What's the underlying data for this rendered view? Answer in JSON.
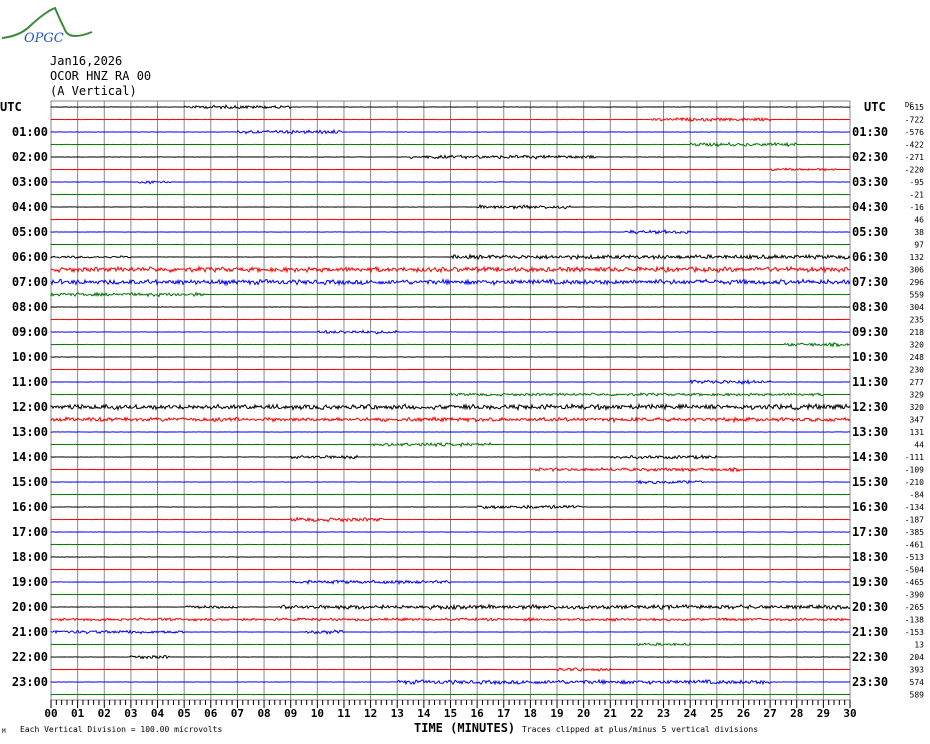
{
  "logo": {
    "text": "OPGC",
    "colors": {
      "curve": "#3a8a3a",
      "text": "#2255cc"
    }
  },
  "header": {
    "date": "Jan16,2026",
    "station": "OCOR HNZ RA 00",
    "component": "(A Vertical)"
  },
  "footer": {
    "corner": "M",
    "scale_note": "Each Vertical Division =  100.00 microvolts",
    "clip_note": "Traces clipped at plus/minus 5 vertical divisions"
  },
  "chart_data": {
    "type": "line",
    "title": "OCOR HNZ RA 00 helicorder",
    "xlabel": "TIME (MINUTES)",
    "xlim": [
      0,
      30
    ],
    "x_ticks": [
      "00",
      "01",
      "02",
      "03",
      "04",
      "05",
      "06",
      "07",
      "08",
      "09",
      "10",
      "11",
      "12",
      "13",
      "14",
      "15",
      "16",
      "17",
      "18",
      "19",
      "20",
      "21",
      "22",
      "23",
      "24",
      "25",
      "26",
      "27",
      "28",
      "29",
      "30"
    ],
    "left_axis_title": "UTC",
    "right_axis_title": "UTC",
    "offset_title": "DC",
    "left_labels": [
      "",
      "01:00",
      "02:00",
      "03:00",
      "04:00",
      "05:00",
      "06:00",
      "07:00",
      "08:00",
      "09:00",
      "10:00",
      "11:00",
      "12:00",
      "13:00",
      "14:00",
      "15:00",
      "16:00",
      "17:00",
      "18:00",
      "19:00",
      "20:00",
      "21:00",
      "22:00",
      "23:00"
    ],
    "right_labels": [
      "",
      "01:30",
      "02:30",
      "03:30",
      "04:30",
      "05:30",
      "06:30",
      "07:30",
      "08:30",
      "09:30",
      "10:30",
      "11:30",
      "12:30",
      "13:30",
      "14:30",
      "15:30",
      "16:30",
      "17:30",
      "18:30",
      "19:30",
      "20:30",
      "21:30",
      "22:30",
      "23:30"
    ],
    "offsets": [
      "615",
      "-722",
      "-576",
      "-422",
      "-271",
      "-220",
      "-95",
      "-21",
      "-16",
      "46",
      "38",
      "97",
      "132",
      "306",
      "296",
      "559",
      "304",
      "235",
      "218",
      "320",
      "248",
      "230",
      "277",
      "329",
      "320",
      "347",
      "131",
      "44",
      "-111",
      "-109",
      "-210",
      "-84",
      "-134",
      "-187",
      "-385",
      "-461",
      "-513",
      "-504",
      "-465",
      "-390",
      "-265",
      "-138",
      "-153",
      "13",
      "204",
      "393",
      "574",
      "589"
    ],
    "trace_colors": [
      "#000000",
      "#ff0000",
      "#0000ff",
      "#007700"
    ],
    "trace_count": 48,
    "bursts": [
      [
        0,
        5,
        9,
        1.5
      ],
      [
        1,
        22.5,
        27,
        1.5
      ],
      [
        2,
        7,
        11,
        1.5
      ],
      [
        3,
        24,
        28,
        1.5
      ],
      [
        4,
        13.5,
        20.5,
        1.5
      ],
      [
        5,
        27,
        29.5,
        1
      ],
      [
        6,
        3.3,
        4.5,
        1.5
      ],
      [
        8,
        16,
        19.5,
        1.5
      ],
      [
        10,
        21.5,
        24,
        1.5
      ],
      [
        12,
        0,
        3,
        1
      ],
      [
        12,
        15,
        30,
        1.8
      ],
      [
        13,
        0,
        30,
        2.2
      ],
      [
        14,
        0,
        30,
        2.2
      ],
      [
        15,
        0,
        5.8,
        1.5
      ],
      [
        18,
        10,
        13,
        1.5
      ],
      [
        19,
        27.5,
        30,
        1.5
      ],
      [
        22,
        24,
        27,
        1.8
      ],
      [
        23,
        15,
        29,
        1.2
      ],
      [
        24,
        0,
        30,
        2.2
      ],
      [
        25,
        0,
        30,
        1.8
      ],
      [
        27,
        12,
        16.5,
        1.5
      ],
      [
        28,
        9,
        11.5,
        1.5
      ],
      [
        28,
        21,
        25,
        1.5
      ],
      [
        29,
        18,
        26,
        1.5
      ],
      [
        30,
        22,
        24.5,
        1.5
      ],
      [
        32,
        16,
        20,
        1.5
      ],
      [
        33,
        9,
        12.5,
        1.8
      ],
      [
        38,
        9,
        15,
        1.5
      ],
      [
        40,
        5,
        7,
        1.2
      ],
      [
        40,
        8.5,
        30,
        1.8
      ],
      [
        41,
        0,
        30,
        1.2
      ],
      [
        42,
        0,
        5,
        1.5
      ],
      [
        42,
        9.5,
        11,
        1.5
      ],
      [
        43,
        22,
        24,
        1.2
      ],
      [
        44,
        3,
        4.5,
        1.5
      ],
      [
        45,
        19,
        21,
        1.5
      ],
      [
        46,
        13,
        27,
        1.8
      ]
    ]
  }
}
